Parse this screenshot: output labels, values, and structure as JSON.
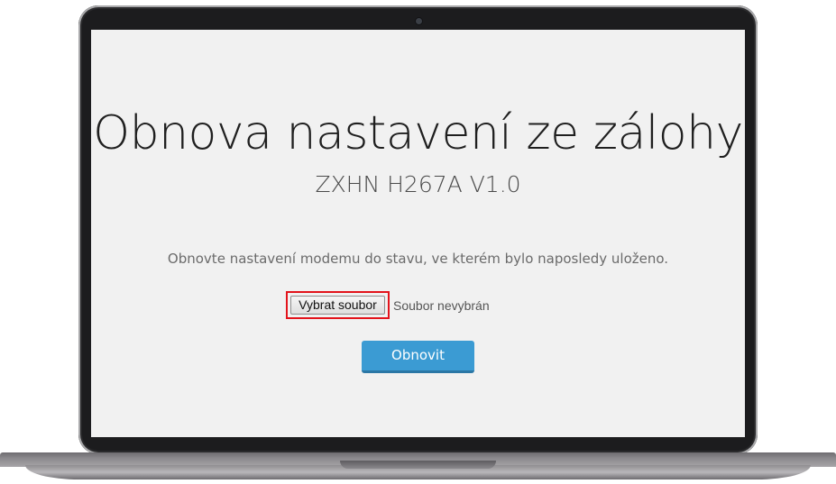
{
  "page": {
    "title": "Obnova nastavení ze zálohy",
    "subtitle": "ZXHN H267A V1.0",
    "description": "Obnovte nastavení modemu do stavu, ve kterém bylo naposledy uloženo."
  },
  "file_input": {
    "button_label": "Vybrat soubor",
    "status_text": "Soubor nevybrán",
    "highlight_color": "#e3131b"
  },
  "actions": {
    "restore_label": "Obnovit",
    "restore_color": "#3b9bd3"
  }
}
